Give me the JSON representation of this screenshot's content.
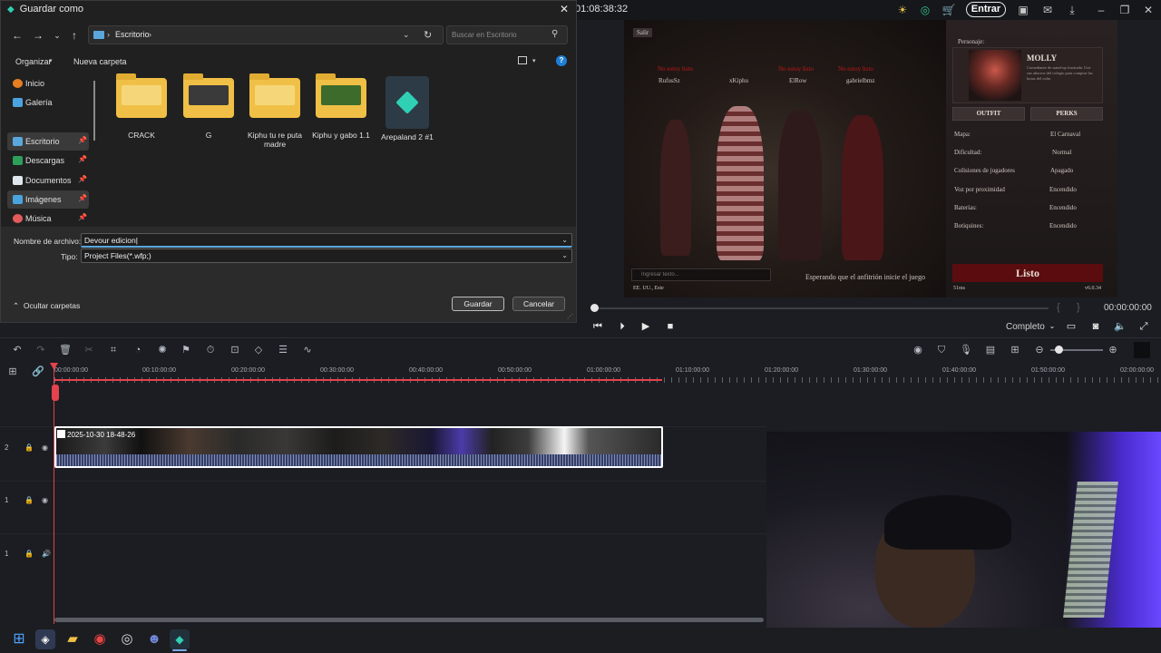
{
  "editor": {
    "timecode_top": "01:08:38:32",
    "login_label": "Entrar",
    "time_right": "00:00:00:00",
    "quality": "Completo"
  },
  "game": {
    "exit_label": "Salir",
    "character_label": "Personaje:",
    "character_name": "MOLLY",
    "character_desc": "Comediante de stand-up frustrada. Usó sus ahorros del colegio para comprar las botas del culto.",
    "tab_outfit": "OUTFIT",
    "tab_perks": "PERKS",
    "players": [
      {
        "status": "No estoy listo",
        "name": "RufusSz"
      },
      {
        "status": "",
        "name": "xKiphu"
      },
      {
        "status": "No estoy listo",
        "name": "ElRow"
      },
      {
        "status": "No estoy listo",
        "name": "gabrielbmz"
      }
    ],
    "settings": [
      {
        "label": "Mapa:",
        "value": "El Carnaval"
      },
      {
        "label": "Dificultad:",
        "value": "Normal"
      },
      {
        "label": "Colisiones de jugadores",
        "value": "Apagado"
      },
      {
        "label": "Voz por proximidad",
        "value": "Encendido"
      },
      {
        "label": "Baterías:",
        "value": "Encendido"
      },
      {
        "label": "Botiquines:",
        "value": "Encendido"
      }
    ],
    "chat_placeholder": "Ingresar texto...",
    "waiting_text": "Esperando que el anfitrión inicie el juego",
    "ready_label": "Listo",
    "region": "EE. UU., Este",
    "ping": "51ms",
    "version": "v6.0.34"
  },
  "timeline": {
    "ruler_labels": [
      "00:00:00:00",
      "00:10:00:00",
      "00:20:00:00",
      "00:30:00:00",
      "00:40:00:00",
      "00:50:00:00",
      "01:00:00:00",
      "01:10:00:00",
      "01:20:00:00",
      "01:30:00:00",
      "01:40:00:00",
      "01:50:00:00",
      "02:00:00:00"
    ],
    "clip_label": "2025-10-30 18-48-26",
    "track_numbers": [
      "2",
      "1",
      "1"
    ]
  },
  "dialog": {
    "title": "Guardar como",
    "path_segment": "Escritorio",
    "search_placeholder": "Buscar en Escritorio",
    "organize_label": "Organizar",
    "new_folder_label": "Nueva carpeta",
    "sidebar": [
      {
        "label": "Inicio",
        "pinned": false
      },
      {
        "label": "Galería",
        "pinned": false
      },
      {
        "label": "Escritorio",
        "pinned": true
      },
      {
        "label": "Descargas",
        "pinned": true
      },
      {
        "label": "Documentos",
        "pinned": true
      },
      {
        "label": "Imágenes",
        "pinned": true
      },
      {
        "label": "Música",
        "pinned": true
      }
    ],
    "files": [
      {
        "name": "CRACK",
        "type": "folder"
      },
      {
        "name": "G",
        "type": "folder"
      },
      {
        "name": "Kiphu tu re puta madre",
        "type": "folder"
      },
      {
        "name": "Kiphu y gabo 1.1",
        "type": "folder"
      },
      {
        "name": "Arepaland 2 #1",
        "type": "project"
      }
    ],
    "filename_label": "Nombre de archivo:",
    "filename_value": "Devour edicion",
    "type_label": "Tipo:",
    "type_value": "Project Files(*.wfp;)",
    "hide_folders_label": "Ocultar carpetas",
    "save_label": "Guardar",
    "cancel_label": "Cancelar"
  },
  "colors": {
    "playhead": "#e4424d",
    "accent": "#1e7fd6",
    "game_red": "#c0181b"
  }
}
